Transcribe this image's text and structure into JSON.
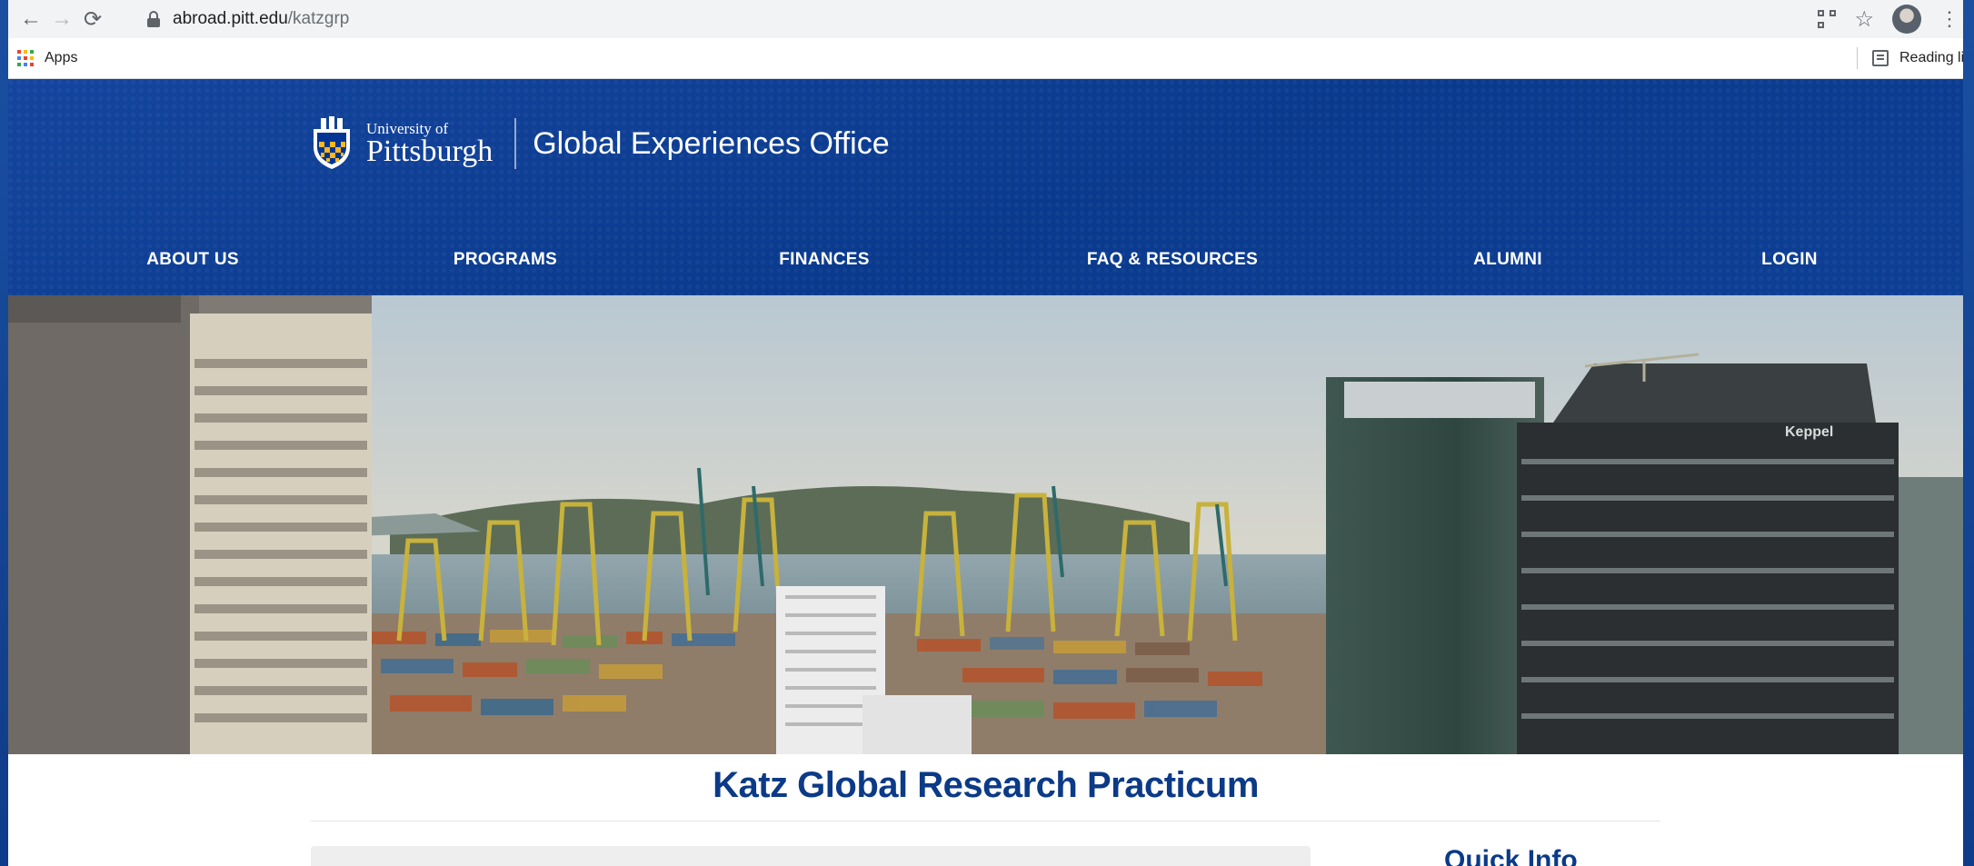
{
  "browser": {
    "url_host": "abroad.pitt.edu",
    "url_path": "/katzgrp",
    "bookmarks": {
      "apps_label": "Apps",
      "reading_list_label": "Reading list"
    }
  },
  "site": {
    "logo": {
      "university_small": "University of",
      "university_big": "Pittsburgh"
    },
    "office_title": "Global Experiences Office",
    "nav": [
      "ABOUT US",
      "PROGRAMS",
      "FINANCES",
      "FAQ & RESOURCES",
      "ALUMNI",
      "LOGIN"
    ]
  },
  "hero": {
    "sign_text": "Keppel"
  },
  "page": {
    "title": "Katz Global Research Practicum",
    "sidebar_heading": "Quick Info"
  },
  "colors": {
    "brand_blue": "#0b3a87",
    "header_blue": "#12469a",
    "pitt_gold": "#ffb81c"
  }
}
